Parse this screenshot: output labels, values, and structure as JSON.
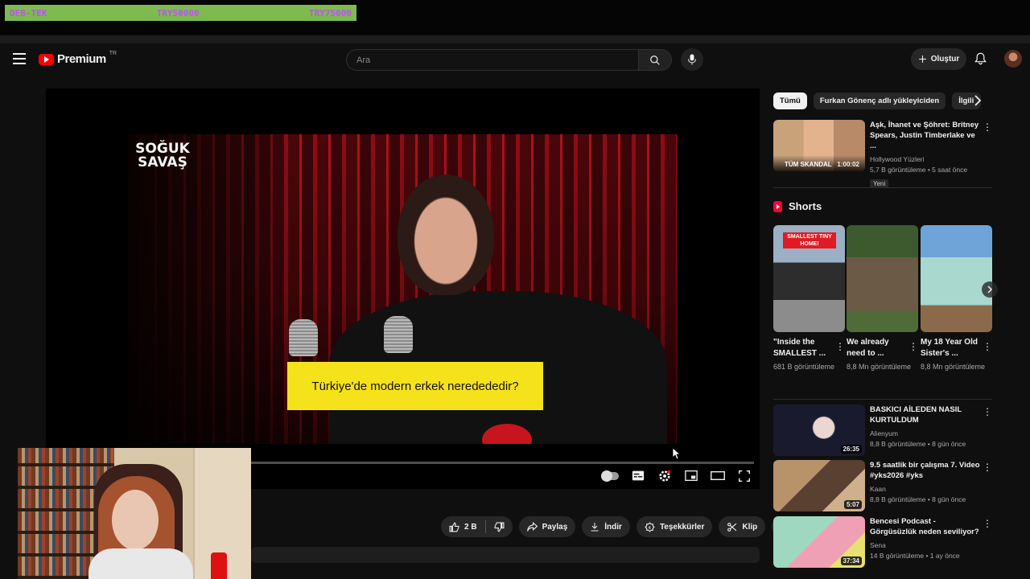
{
  "overlay": {
    "banner_left": "DEB-TEK",
    "banner_mid": "TRY50000",
    "banner_right": "TRY75000"
  },
  "header": {
    "logo_text": "Premium",
    "logo_region": "TR",
    "search_placeholder": "Ara",
    "create_label": "Oluştur"
  },
  "player": {
    "show_logo": "SOĞUK SAVAŞ",
    "caption": "Türkiye'de modern erkek neredede​dir?",
    "progress_percent": 0
  },
  "actions": {
    "likes": "2 B",
    "share": "Paylaş",
    "download": "İndir",
    "thanks": "Teşekkürler",
    "clip": "Klip"
  },
  "chips": [
    "Tümü",
    "Furkan Gönenç adlı yükleyiciden",
    "İlgili"
  ],
  "recommendations_top": [
    {
      "title": "Aşk, İhanet ve Şöhret: Britney Spears, Justin Timberlake ve ...",
      "channel": "Hollywood Yüzleri",
      "meta": "5,7 B görüntüleme • 5 saat önce",
      "badge": "Yeni",
      "duration": "1:00:02",
      "thumb_text": "TÜM SKANDAL"
    }
  ],
  "shorts": {
    "heading": "Shorts",
    "items": [
      {
        "title": "\"Inside the SMALLEST ...",
        "views": "681 B görüntüleme",
        "thumb_text": "SMALLEST TINY HOME!"
      },
      {
        "title": "We already need to ...",
        "views": "8,8 Mn görüntüleme",
        "thumb_text": ""
      },
      {
        "title": "My 18 Year Old Sister's ...",
        "views": "8,8 Mn görüntüleme",
        "thumb_text": ""
      }
    ]
  },
  "recommendations": [
    {
      "title": "BASKICI AİLEDEN NASIL KURTULDUM",
      "channel": "Alienyum",
      "meta": "8,8 B görüntüleme • 8 gün önce",
      "duration": "26:35"
    },
    {
      "title": "9.5 saatlik bir çalışma 7. Video #yks2026 #yks",
      "channel": "Kaan",
      "meta": "8,8 B görüntüleme • 8 gün önce",
      "duration": "5:07"
    },
    {
      "title": "Bencesi Podcast - Görgüsüzlük neden seviliyor?",
      "channel": "Sena",
      "meta": "14 B görüntüleme • 1 ay önce",
      "duration": "37:34"
    }
  ],
  "colors": {
    "background": "#0f0f0f",
    "brand_red": "#ff0000",
    "caption_yellow": "#f6e21b",
    "banner_green": "#7dbb4e",
    "banner_text": "#c24dff"
  },
  "icons": [
    "menu-icon",
    "search-icon",
    "mic-icon",
    "plus-icon",
    "bell-icon",
    "settings-icon",
    "subtitles-icon",
    "miniplayer-icon",
    "theater-icon",
    "fullscreen-icon",
    "like-icon",
    "dislike-icon",
    "share-icon",
    "download-icon",
    "thanks-icon",
    "clip-icon",
    "more-icon"
  ]
}
